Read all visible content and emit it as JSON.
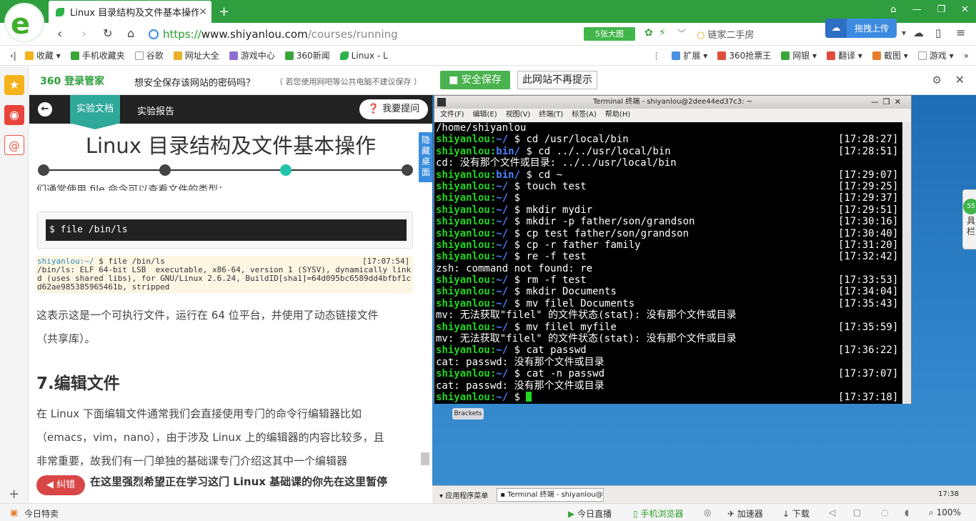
{
  "browser": {
    "tab_title": "Linux 目录结构及文件基本操作",
    "url_scheme": "https://",
    "url_host": "www.shiyanlou.com",
    "url_path": "/courses/running",
    "big_images_label": "5张大图",
    "search_hint": "链家二手房",
    "upload_label": "拖拽上传",
    "bookmarks": [
      "收藏",
      "手机收藏夹",
      "谷歌",
      "网址大全",
      "游戏中心",
      "360新闻",
      "Linux - L"
    ],
    "bookmarks_right": [
      "扩展",
      "360抢票王",
      "网银",
      "翻译",
      "截图",
      "游戏"
    ]
  },
  "password_bar": {
    "brand": "360 登录管家",
    "question": "想安全保存该网站的密码吗？",
    "note": "（ 若您使用网吧等公共电脑不建议保存 ）",
    "save_label": "安全保存",
    "never_label": "此网站不再提示"
  },
  "doc": {
    "tab_doc": "实验文档",
    "tab_report": "实验报告",
    "ask_label": "我要提问",
    "title": "Linux 目录结构及文件基本操作",
    "hide_desktop": "隐藏桌面",
    "partial_line": "们通常使用 file 命令可以查看文件的类型：",
    "cmd": "$ file /bin/ls",
    "out_user": "shiyanlou:~/",
    "out_cmd": " $ file /bin/ls",
    "out_time": "[17:07:54]",
    "out_line2": "/bin/ls: ELF 64-bit LSB  executable, x86-64, version 1 (SYSV), dynamically linke",
    "out_line3": "d (uses shared libs), for GNU/Linux 2.6.24, BuildID[sha1]=64d095bc6589dd4bfbf1c6",
    "out_line4": "d62ae985385965461b, stripped",
    "para1a": "这表示这是一个可执行文件，运行在 64 位平台，并使用了动态链接文件",
    "para1b": "（共享库）。",
    "heading": "7.编辑文件",
    "para2a": "在 Linux 下面编辑文件通常我们会直接使用专门的命令行编辑器比如",
    "para2b": "（emacs，vim，nano），由于涉及 Linux 上的编辑器的内容比较多，且",
    "para2c": "非常重要，故我们有一门单独的基础课专门介绍这其中一个编辑器",
    "bug_label": "纠错",
    "bold_line": "在这里强烈希望正在学习这门 Linux 基础课的你先在这里暂停"
  },
  "terminal": {
    "window_title": "Terminal 终端 - shiyanlou@2dee44ed37c3: ~",
    "menus": [
      "文件(F)",
      "编辑(E)",
      "视图(V)",
      "终端(T)",
      "标签(A)",
      "帮助(H)"
    ],
    "lines": [
      {
        "plain": "/home/shiyanlou"
      },
      {
        "user": "shiyanlou:",
        "dir": "~/",
        "cmd": " $ cd /usr/local/bin",
        "time": "[17:28:27]"
      },
      {
        "user": "shiyanlou:",
        "dir": "bin/",
        "cmd": " $ cd ../../usr/local/bin",
        "time": "[17:28:51]"
      },
      {
        "plain": "cd: 没有那个文件或目录: ../../usr/local/bin"
      },
      {
        "user": "shiyanlou:",
        "dir": "bin/",
        "cmd": " $ cd ~",
        "time": "[17:29:07]"
      },
      {
        "user": "shiyanlou:",
        "dir": "~/",
        "cmd": " $ touch test",
        "time": "[17:29:25]"
      },
      {
        "user": "shiyanlou:",
        "dir": "~/",
        "cmd": " $",
        "time": "[17:29:37]"
      },
      {
        "user": "shiyanlou:",
        "dir": "~/",
        "cmd": " $ mkdir mydir",
        "time": "[17:29:51]"
      },
      {
        "user": "shiyanlou:",
        "dir": "~/",
        "cmd": " $ mkdir -p father/son/grandson",
        "time": "[17:30:16]"
      },
      {
        "user": "shiyanlou:",
        "dir": "~/",
        "cmd": " $ cp test father/son/grandson",
        "time": "[17:30:40]"
      },
      {
        "user": "shiyanlou:",
        "dir": "~/",
        "cmd": " $ cp -r father family",
        "time": "[17:31:20]"
      },
      {
        "user": "shiyanlou:",
        "dir": "~/",
        "cmd": " $ re -f test",
        "time": "[17:32:42]"
      },
      {
        "plain": "zsh: command not found: re"
      },
      {
        "user": "shiyanlou:",
        "dir": "~/",
        "cmd": " $ rm -f test",
        "time": "[17:33:53]"
      },
      {
        "user": "shiyanlou:",
        "dir": "~/",
        "cmd": " $ mkdir Documents",
        "time": "[17:34:04]"
      },
      {
        "user": "shiyanlou:",
        "dir": "~/",
        "cmd": " $ mv filel Documents",
        "time": "[17:35:43]"
      },
      {
        "plain": "mv: 无法获取\"filel\" 的文件状态(stat): 没有那个文件或目录"
      },
      {
        "user": "shiyanlou:",
        "dir": "~/",
        "cmd": " $ mv filel myfile",
        "time": "[17:35:59]"
      },
      {
        "plain": "mv: 无法获取\"filel\" 的文件状态(stat): 没有那个文件或目录"
      },
      {
        "user": "shiyanlou:",
        "dir": "~/",
        "cmd": " $ cat passwd",
        "time": "[17:36:22]"
      },
      {
        "plain": "cat: passwd: 没有那个文件或目录"
      },
      {
        "user": "shiyanlou:",
        "dir": "~/",
        "cmd": " $ cat -n passwd",
        "time": "[17:37:07]"
      },
      {
        "plain": "cat: passwd: 没有那个文件或目录"
      },
      {
        "user": "shiyanlou:",
        "dir": "~/",
        "cmd": " $ ",
        "time": "[17:37:18]",
        "cursor": true
      }
    ]
  },
  "desktop": {
    "brackets": "Brackets",
    "app_menu": "应用程序菜单",
    "task": "Terminal 终端 - shiyanlou@...",
    "clock": "17:38",
    "edge_badge": "55",
    "edge_label": "具栏"
  },
  "statusbar": {
    "left": "今日特卖",
    "live": "今日直播",
    "mobile": "手机浏览器",
    "accel": "加速器",
    "download": "下载",
    "zoom": "100%"
  }
}
